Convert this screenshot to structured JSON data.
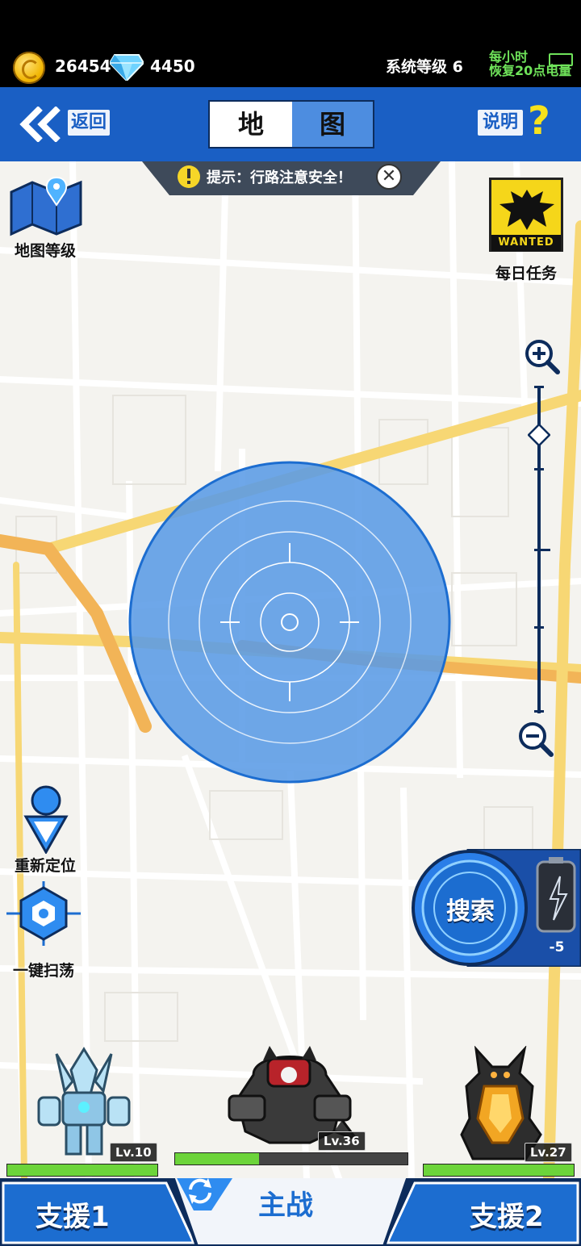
{
  "resources": {
    "coins": "26454",
    "gems": "4450",
    "system_level": "系统等级 6",
    "recover_line1": "每小时",
    "recover_line2": "恢复20点电量"
  },
  "header": {
    "back_label": "返回",
    "title_part1": "地",
    "title_part2": "图",
    "help_label": "说明",
    "help_icon": "question-icon"
  },
  "tip": {
    "text": "提示：行路注意安全！",
    "close_symbol": "✕"
  },
  "map": {
    "map_level_label": "地图等级",
    "wanted_text": "WANTED",
    "daily_task_label": "每日任务",
    "relocate_label": "重新定位",
    "sweep_label": "一键扫荡",
    "zoom_level": 0.85,
    "colors": {
      "road_major": "#f7d774",
      "road_orange": "#f2b457",
      "road_minor": "#ffffff",
      "scan_circle": "#5a9be6"
    }
  },
  "search": {
    "label": "搜索",
    "energy_cost": "-5"
  },
  "team": {
    "support1": {
      "level": "Lv.10",
      "hp": 1.0,
      "label": "支援1"
    },
    "main": {
      "level": "Lv.36",
      "hp": 0.36,
      "label": "主战"
    },
    "support2": {
      "level": "Lv.27",
      "hp": 1.0,
      "label": "支援2"
    }
  }
}
